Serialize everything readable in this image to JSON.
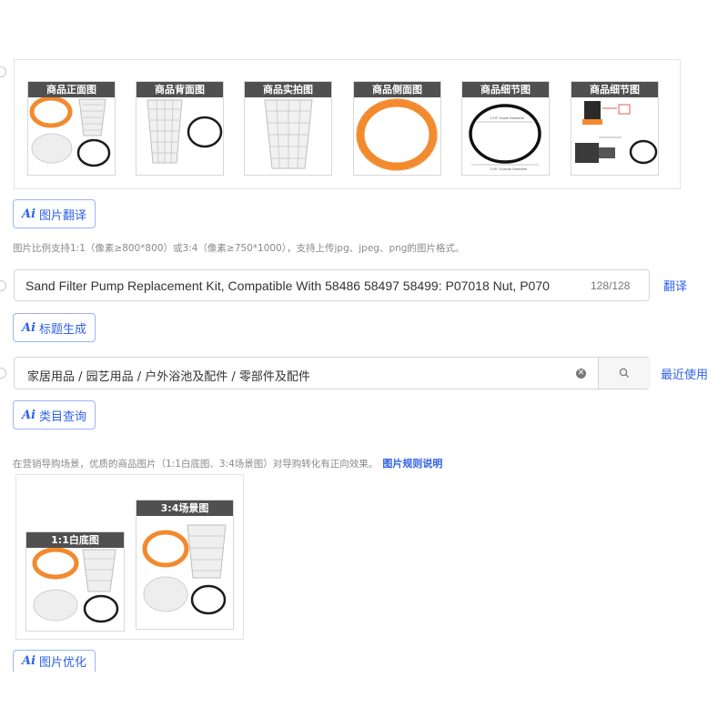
{
  "image_section": {
    "thumbnails": [
      {
        "label": "商品正面图",
        "icon": "kit-front-image"
      },
      {
        "label": "商品背面图",
        "icon": "basket-back-image"
      },
      {
        "label": "商品实拍图",
        "icon": "basket-photo-image"
      },
      {
        "label": "商品侧面图",
        "icon": "nut-side-image"
      },
      {
        "label": "商品细节图",
        "icon": "oring-detail-image"
      },
      {
        "label": "商品细节图",
        "icon": "pump-detail-image"
      }
    ],
    "diagram_text": {
      "top": "1.93\" Inside Diameter",
      "bottom": "1.95\" Outside Diameter"
    },
    "translate_button": {
      "ai": "Ai",
      "label": "图片翻译"
    },
    "hint": "图片比例支持1:1（像素≥800*800）或3:4（像素≥750*1000），支持上传jpg、jpeg、png的图片格式。"
  },
  "title_section": {
    "value": "Sand Filter Pump Replacement Kit, Compatible With 58486 58497 58499: P07018 Nut, P070",
    "counter": "128/128",
    "translate_link": "翻译",
    "generate_button": {
      "ai": "Ai",
      "label": "标题生成"
    }
  },
  "category_section": {
    "value": "家居用品 / 园艺用品 / 户外浴池及配件 / 零部件及配件",
    "recent_link": "最近使用",
    "query_button": {
      "ai": "Ai",
      "label": "类目查询"
    }
  },
  "marketing_section": {
    "hint": "在营销导购场景，优质的商品图片（1:1白底图、3:4场景图）对导购转化有正向效果。",
    "rules_link": "图片规则说明",
    "white_bg_label": "1:1白底图",
    "scene_label": "3:4场景图",
    "optimize_button": {
      "ai": "Ai",
      "label": "图片优化"
    }
  },
  "colors": {
    "accent": "#2f62e8",
    "orange": "#f28a2e",
    "label_bg": "#505050"
  }
}
